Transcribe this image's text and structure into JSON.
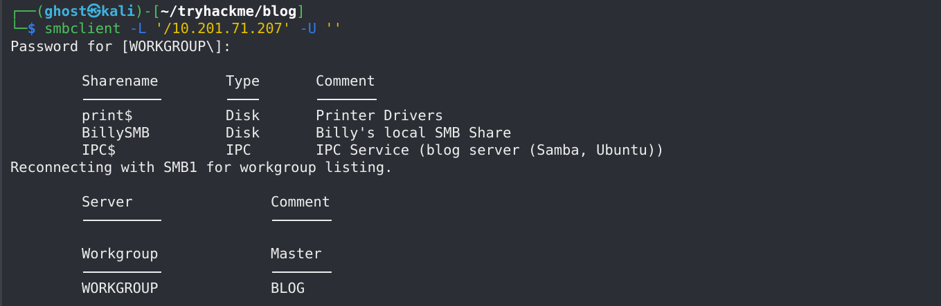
{
  "prompt": {
    "corner_top": "┌──(",
    "user": "ghost",
    "at_symbol": "㉿",
    "host": "kali",
    "bracket_mid": ")-[",
    "cwd": "~/tryhackme/blog",
    "bracket_close": "]",
    "corner_bottom": "└─",
    "dollar": "$",
    "command": "smbclient",
    "args_flag": "-L",
    "args_target": "'/10.201.71.207'",
    "args_user_flag": "-U",
    "args_user": "''"
  },
  "output": {
    "password_prompt": "Password for [WORKGROUP\\]:",
    "shares_header": {
      "sharename": "Sharename",
      "type": "Type",
      "comment": "Comment"
    },
    "shares": [
      {
        "name": "print$",
        "type": "Disk",
        "comment": "Printer Drivers"
      },
      {
        "name": "BillySMB",
        "type": "Disk",
        "comment": "Billy's local SMB Share"
      },
      {
        "name": "IPC$",
        "type": "IPC",
        "comment": "IPC Service (blog server (Samba, Ubuntu))"
      }
    ],
    "reconnect_msg": "Reconnecting with SMB1 for workgroup listing.",
    "server_header": {
      "server": "Server",
      "comment": "Comment"
    },
    "workgroup_header": {
      "workgroup": "Workgroup",
      "master": "Master"
    },
    "workgroups": [
      {
        "workgroup": "WORKGROUP",
        "master": "BLOG"
      }
    ]
  }
}
